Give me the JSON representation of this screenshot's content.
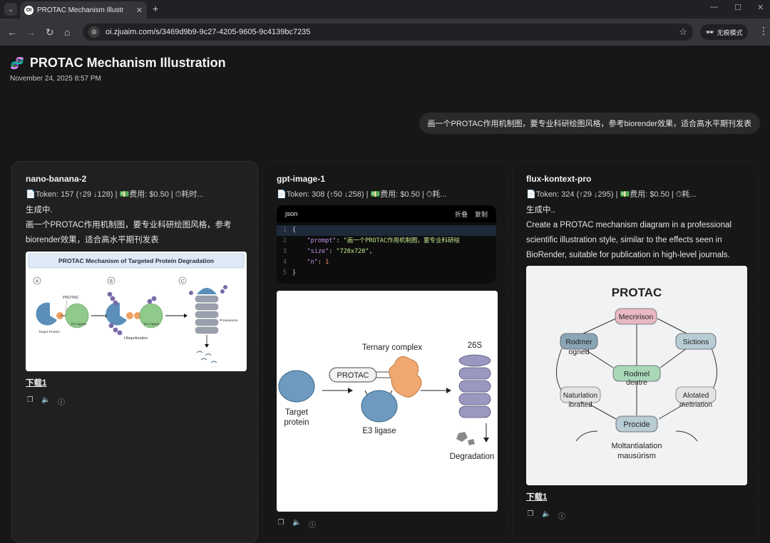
{
  "browser": {
    "tab_title": "PROTAC Mechanism Illustr",
    "tab_favicon": "OI",
    "url": "oi.zjuaim.com/s/3469d9b9-9c27-4205-9605-9c4139bc7235",
    "incognito_label": "无痕模式"
  },
  "page": {
    "title": "PROTAC Mechanism Illustration",
    "date": "November 24, 2025 8:57 PM"
  },
  "user_message": "画一个PROTAC作用机制图，要专业科研绘图风格，参考biorender效果，适合高水平期刊发表",
  "cards": [
    {
      "model": "nano-banana-2",
      "tokens": "📄Token: 157 (↑29 ↓128) | 💵费用: $0.50 | ⏱耗时...",
      "status": "生成中.",
      "body": "画一个PROTAC作用机制图，要专业科研绘图风格，参考biorender效果，适合高水平期刊发表",
      "download": "下载1",
      "image": {
        "title": "PROTAC Mechanism of Targeted Protein Degradation",
        "step_a": "A",
        "step_b": "B",
        "step_c": "C",
        "protac": "PROTAC",
        "target": "Target Protein",
        "e3": "E3 Ligase",
        "e3_b": "E3 Ligase",
        "ubiquitination": "Ubiquitination",
        "proteasome": "Proteasome"
      }
    },
    {
      "model": "gpt-image-1",
      "tokens": "📄Token: 308 (↑50 ↓258) | 💵费用: $0.50 | ⏱耗...",
      "json_label": "json",
      "json_ops": [
        "折叠",
        "复制"
      ],
      "json_lines": [
        {
          "ln": "1",
          "code": "{"
        },
        {
          "ln": "2",
          "key": "\"prompt\"",
          "val": "\"画一个PROTAC作用机制图，要专业科研绘"
        },
        {
          "ln": "3",
          "key": "\"size\"",
          "val": "\"720x720\","
        },
        {
          "ln": "4",
          "key": "\"n\"",
          "num": "1"
        },
        {
          "ln": "5",
          "code": "}"
        }
      ],
      "image": {
        "ternary": "Ternary complex",
        "protac": "PROTAC",
        "target": "Target\nprotein",
        "e3": "E3 ligase",
        "proteasome": "26S",
        "degradation": "Degradation"
      },
      "download": ""
    },
    {
      "model": "flux-kontext-pro",
      "tokens": "📄Token: 324 (↑29 ↓295) | 💵费用: $0.50 | ⏱耗...",
      "status": "生成中..",
      "body": "Create a PROTAC mechanism diagram in a professional scientific illustration style, similar to the effects seen in BioRender, suitable for publication in high-level journals.",
      "download": "下载1",
      "image": {
        "title": "PROTAC",
        "n1": "Mecririson",
        "n2": "Rodmer",
        "n2b": "ogned",
        "n3": "Sictions",
        "n4": "Rodmel",
        "n4b": "dentre",
        "n5": "Naturlation",
        "n5b": "ibrafted",
        "n6": "Alotated",
        "n6b": "meltriation",
        "n7": "Procide",
        "foot1": "Moltantialation",
        "foot2": "mausúrism"
      }
    }
  ],
  "colors": {
    "bg": "#171717",
    "card": "#202020",
    "protein_blue": "#5b8fb9",
    "e3_green": "#8fca8a",
    "ligand_orange": "#f0a060",
    "proteasome_gray": "#9a9ab8"
  }
}
